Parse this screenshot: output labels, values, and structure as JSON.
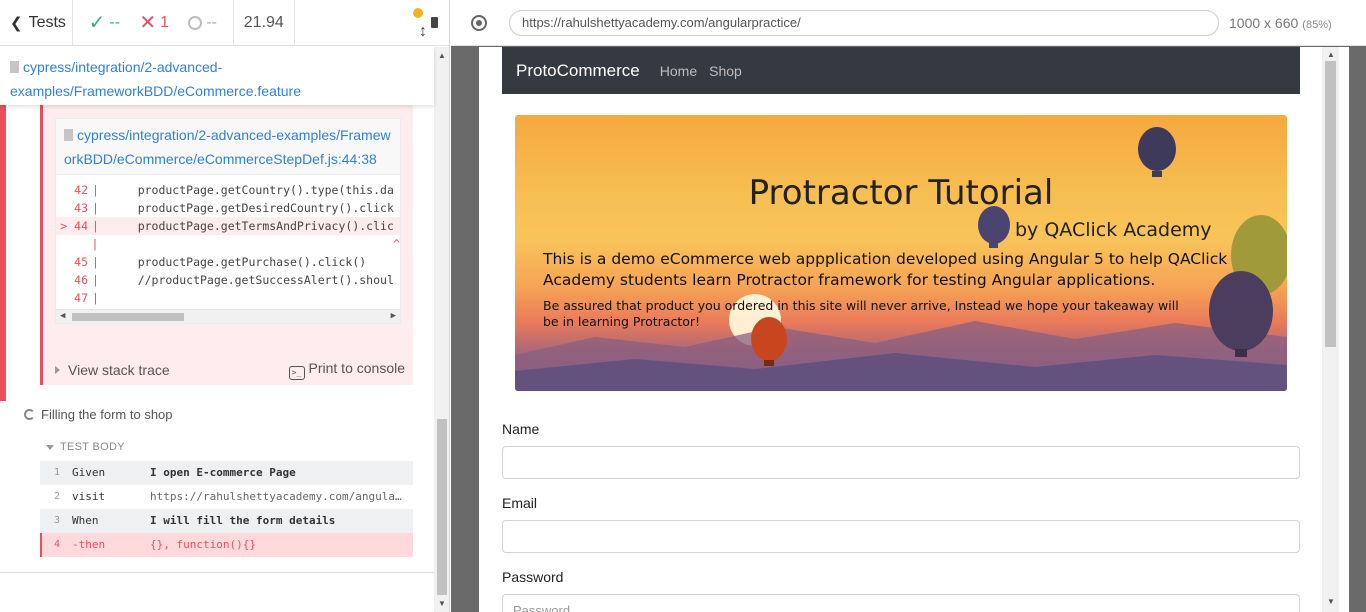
{
  "reporter": {
    "tests_label": "Tests",
    "passed": "--",
    "failed": "1",
    "pending": "--",
    "duration": "21.94"
  },
  "spec": {
    "path": "cypress/integration/2-advanced-examples/FrameworkBDD/eCommerce.feature"
  },
  "error": {
    "file": "cypress/integration/2-advanced-examples/FrameworkBDD/eCommerce/eCommerceStepDef.js:44:38",
    "code_lines": [
      {
        "num": "42",
        "marker": "|",
        "text": "    productPage.getCountry().type(this.da"
      },
      {
        "num": "43",
        "marker": "|",
        "text": "    productPage.getDesiredCountry().click"
      },
      {
        "num": "> 44",
        "marker": "|",
        "text": "    productPage.getTermsAndPrivacy().clic"
      },
      {
        "num": "",
        "marker": "|",
        "text": "                                         ^"
      },
      {
        "num": "45",
        "marker": "|",
        "text": "    productPage.getPurchase().click()"
      },
      {
        "num": "46",
        "marker": "|",
        "text": "    //productPage.getSuccessAlert().shoul"
      },
      {
        "num": "47",
        "marker": "|",
        "text": ""
      }
    ],
    "view_stack": "View stack trace",
    "print_console": "Print to console"
  },
  "test": {
    "title": "Filling the form to shop",
    "body_header": "TEST BODY",
    "commands": [
      {
        "num": "1",
        "name": "Given",
        "msg": "I open E-commerce Page",
        "style": "bold"
      },
      {
        "num": "2",
        "name": "visit",
        "msg": "https://rahulshettyacademy.com/angula...",
        "style": "url"
      },
      {
        "num": "3",
        "name": "When",
        "msg": "I will fill the form details",
        "style": "bold"
      },
      {
        "num": "4",
        "name": "-then",
        "msg": "{}, function(){}",
        "style": "failed"
      }
    ]
  },
  "aut": {
    "url": "https://rahulshettyacademy.com/angularpractice/",
    "viewport": "1000 x 660",
    "scale": "(85%)"
  },
  "site": {
    "brand": "ProtoCommerce",
    "nav": [
      "Home",
      "Shop"
    ],
    "banner": {
      "title": "Protractor Tutorial",
      "subtitle": "by QAClick Academy",
      "desc": "This is a demo eCommerce web appplication developed using Angular 5 to help QAClick Academy students learn Protractor framework for testing Angular applications.",
      "note": "Be assured that product you ordered in this site will never arrive, Instead we hope your takeaway will be in learning Protractor!"
    },
    "form": {
      "name_label": "Name",
      "email_label": "Email",
      "password_label": "Password",
      "password_placeholder": "Password"
    }
  },
  "colors": {
    "pass": "#3bb077",
    "fail": "#e94f5f",
    "link": "#3380d6",
    "navbar": "#343a40"
  }
}
